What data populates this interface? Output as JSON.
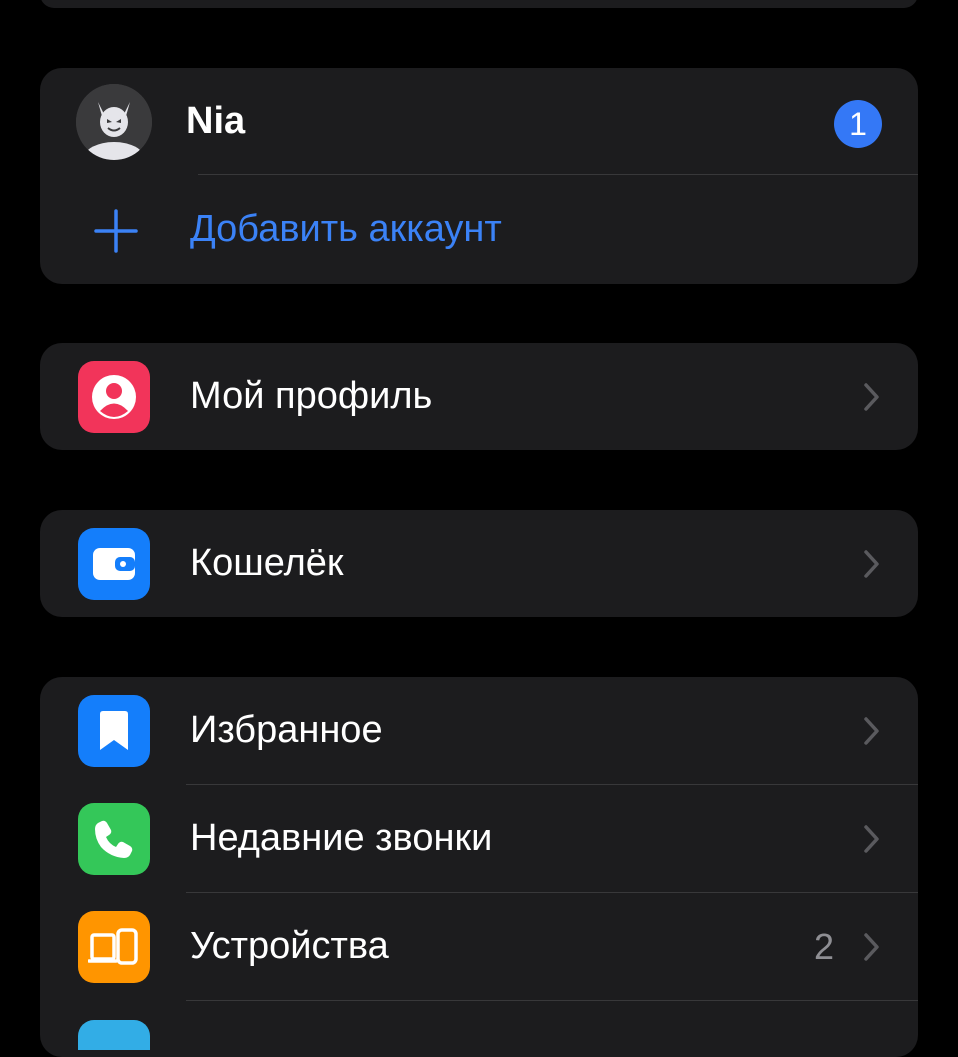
{
  "colors": {
    "background": "#000000",
    "card": "#1c1c1e",
    "separator": "#38383a",
    "accent_blue": "#3b82f6",
    "badge_blue": "#3478f6",
    "secondary_text": "#8e8e93",
    "profile_icon_bg": "#f2345a",
    "wallet_icon_bg": "#147efb",
    "favorites_icon_bg": "#147efb",
    "calls_icon_bg": "#34c759",
    "devices_icon_bg": "#ff9500"
  },
  "accounts": {
    "current": {
      "name": "Nia",
      "badge_count": "1",
      "avatar_icon": "devil-avatar-icon"
    },
    "add_account_label": "Добавить аккаунт",
    "add_icon": "plus-icon"
  },
  "menu": {
    "profile": {
      "label": "Мой профиль",
      "icon": "person-icon"
    },
    "wallet": {
      "label": "Кошелёк",
      "icon": "wallet-icon"
    },
    "favorites": {
      "label": "Избранное",
      "icon": "bookmark-icon"
    },
    "recent_calls": {
      "label": "Недавние звонки",
      "icon": "phone-icon"
    },
    "devices": {
      "label": "Устройства",
      "value": "2",
      "icon": "devices-icon"
    }
  }
}
